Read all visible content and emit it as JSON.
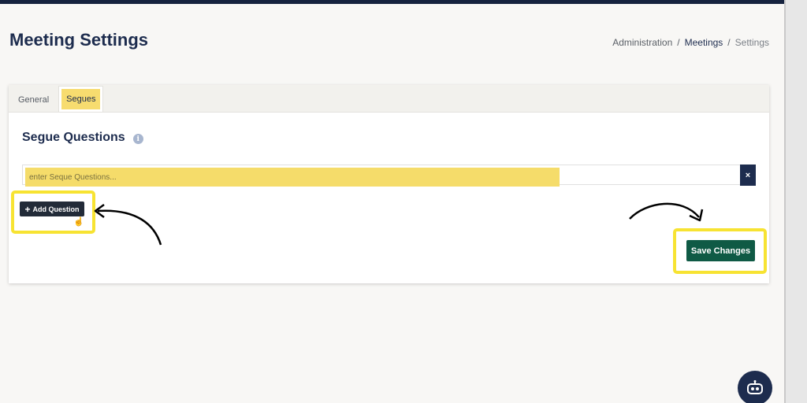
{
  "page": {
    "title": "Meeting Settings"
  },
  "breadcrumb": {
    "items": [
      "Administration",
      "Meetings",
      "Settings"
    ],
    "separator": "/"
  },
  "tabs": [
    {
      "label": "General",
      "active": false
    },
    {
      "label": "Segues",
      "active": true
    }
  ],
  "section": {
    "title": "Segue Questions",
    "info_icon": "i"
  },
  "question_input": {
    "placeholder": "enter Seque Questions...",
    "value": ""
  },
  "remove_button": {
    "label": "×"
  },
  "add_button": {
    "icon": "+",
    "label": "Add Question"
  },
  "save_button": {
    "label": "Save Changes"
  },
  "colors": {
    "navy": "#1d2c4e",
    "highlight": "#f7e332",
    "save": "#0f5a45",
    "input_highlight": "#f5dc6a"
  },
  "icons": [
    "info-icon",
    "close-icon",
    "plus-icon",
    "hand-pointer-icon",
    "arrow-icon",
    "robot-icon"
  ]
}
